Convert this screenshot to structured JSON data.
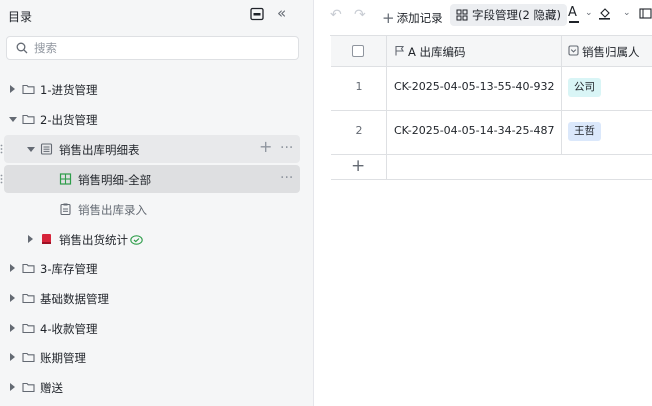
{
  "sidebar": {
    "title": "目录",
    "search_placeholder": "搜索",
    "tree": [
      {
        "label": "1-进货管理"
      },
      {
        "label": "2-出货管理"
      },
      {
        "label": "销售出库明细表"
      },
      {
        "label": "销售明细-全部"
      },
      {
        "label": "销售出库录入"
      },
      {
        "label": "销售出货统计"
      },
      {
        "label": "3-库存管理"
      },
      {
        "label": "基础数据管理"
      },
      {
        "label": "4-收款管理"
      },
      {
        "label": "账期管理"
      },
      {
        "label": "赠送"
      }
    ],
    "row_add": "+",
    "row_more": "···"
  },
  "toolbar": {
    "add_record": "添加记录",
    "field_manage": "字段管理(2 隐藏)"
  },
  "table": {
    "columns": [
      {
        "label": "A 出库编码"
      },
      {
        "label": "销售归属人"
      }
    ],
    "rows": [
      {
        "num": "1",
        "code": "CK-2025-04-05-13-55-40-932",
        "owner": "公司",
        "owner_color": "#d9f5f6"
      },
      {
        "num": "2",
        "code": "CK-2025-04-05-14-34-25-487",
        "owner": "王哲",
        "owner_color": "#dbe8fb"
      }
    ],
    "add_row": "+"
  },
  "colors": {
    "sidebar_bg": "#f5f6f7",
    "selected_bg": "#dedfe1",
    "grid_icon": "#2e9d4a",
    "book_icon": "#d6243a",
    "status_icon": "#2e9d4a"
  }
}
